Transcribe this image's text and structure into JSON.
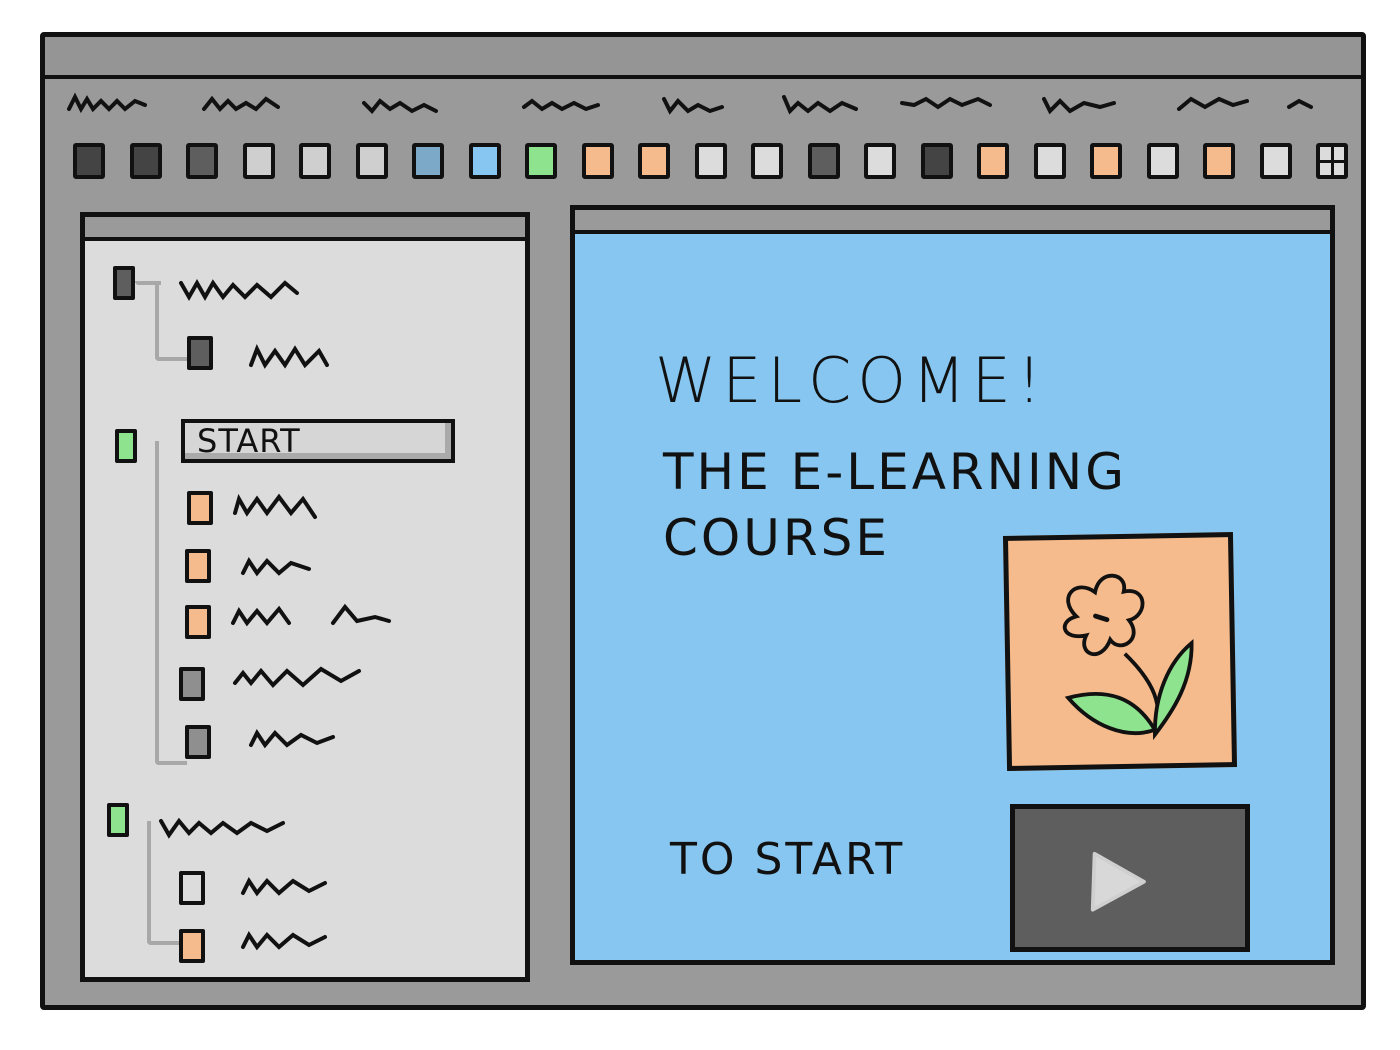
{
  "menubar": {
    "items": [
      "",
      "",
      "",
      "",
      "",
      "",
      "",
      "",
      "",
      ""
    ]
  },
  "toolbar": {
    "tools": [
      {
        "icon": "dark-square-icon",
        "color": "#444444"
      },
      {
        "icon": "dark-square-icon",
        "color": "#444444"
      },
      {
        "icon": "dark-square-icon",
        "color": "#5e5e5e"
      },
      {
        "icon": "square-icon",
        "color": "#cfcfcf"
      },
      {
        "icon": "square-icon",
        "color": "#cfcfcf"
      },
      {
        "icon": "square-icon",
        "color": "#cfcfcf"
      },
      {
        "icon": "blue-square-icon",
        "color": "#7da9c9"
      },
      {
        "icon": "blue-square-icon",
        "color": "#86c6f0"
      },
      {
        "icon": "green-square-icon",
        "color": "#8ee38e"
      },
      {
        "icon": "orange-square-icon",
        "color": "#f6bb8c"
      },
      {
        "icon": "orange-square-icon",
        "color": "#f6bb8c"
      },
      {
        "icon": "square-icon",
        "color": "#dcdcdc"
      },
      {
        "icon": "square-icon",
        "color": "#dcdcdc"
      },
      {
        "icon": "dark-square-icon",
        "color": "#5e5e5e"
      },
      {
        "icon": "square-icon",
        "color": "#dcdcdc"
      },
      {
        "icon": "dark-square-icon",
        "color": "#444444"
      },
      {
        "icon": "orange-square-icon",
        "color": "#f6bb8c"
      },
      {
        "icon": "square-icon",
        "color": "#dcdcdc"
      },
      {
        "icon": "orange-square-icon",
        "color": "#f6bb8c"
      },
      {
        "icon": "square-icon",
        "color": "#dcdcdc"
      },
      {
        "icon": "orange-square-icon",
        "color": "#f6bb8c"
      },
      {
        "icon": "square-icon",
        "color": "#dcdcdc"
      },
      {
        "icon": "grid-icon",
        "color": "#dcdcdc"
      }
    ]
  },
  "tree": {
    "start_label": "START"
  },
  "stage": {
    "welcome": "WELCOME!",
    "subtitle": "THE E-LEARNING COURSE",
    "to_start": "TO START",
    "image_icon": "flower-icon",
    "play_icon": "play-icon"
  },
  "colors": {
    "window": "#9a9a9a",
    "panel": "#dcdcdc",
    "stage": "#86c6f0",
    "green": "#8ee38e",
    "orange": "#f6bb8c",
    "dark": "#5e5e5e"
  }
}
